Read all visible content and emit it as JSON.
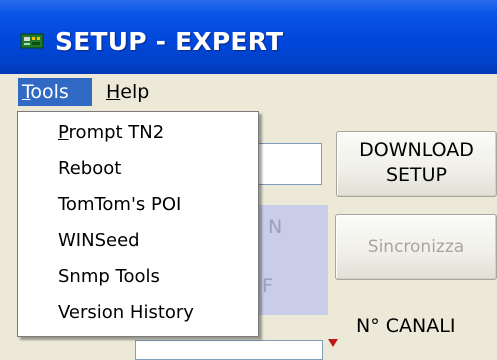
{
  "window": {
    "title": "SETUP - EXPERT",
    "icon": "app-board-icon"
  },
  "menubar": {
    "items": [
      {
        "label": "Tools",
        "mnemonic": "T",
        "rest": "ools",
        "active": true
      },
      {
        "label": "Help",
        "mnemonic": "H",
        "rest": "elp",
        "active": false
      }
    ]
  },
  "tools_menu": {
    "items": [
      {
        "label": "Prompt TN2",
        "mnemonic": "P",
        "rest": "rompt TN2"
      },
      {
        "label": "Reboot"
      },
      {
        "label": "TomTom's POI"
      },
      {
        "label": "WINSeed"
      },
      {
        "label": "Snmp Tools"
      },
      {
        "label": "Version History"
      }
    ]
  },
  "main": {
    "download_button": {
      "line1": "DOWNLOAD",
      "line2": "SETUP"
    },
    "sync_button": {
      "label": "Sincronizza",
      "enabled": false
    },
    "partial_labels": {
      "upper": "N",
      "lower": "F"
    },
    "canali_label": "N° CANALI"
  },
  "colors": {
    "titlebar": "#0047dc",
    "menu_highlight": "#316ac5",
    "disabled_text": "#a8a698",
    "panel": "#c9cde8"
  }
}
